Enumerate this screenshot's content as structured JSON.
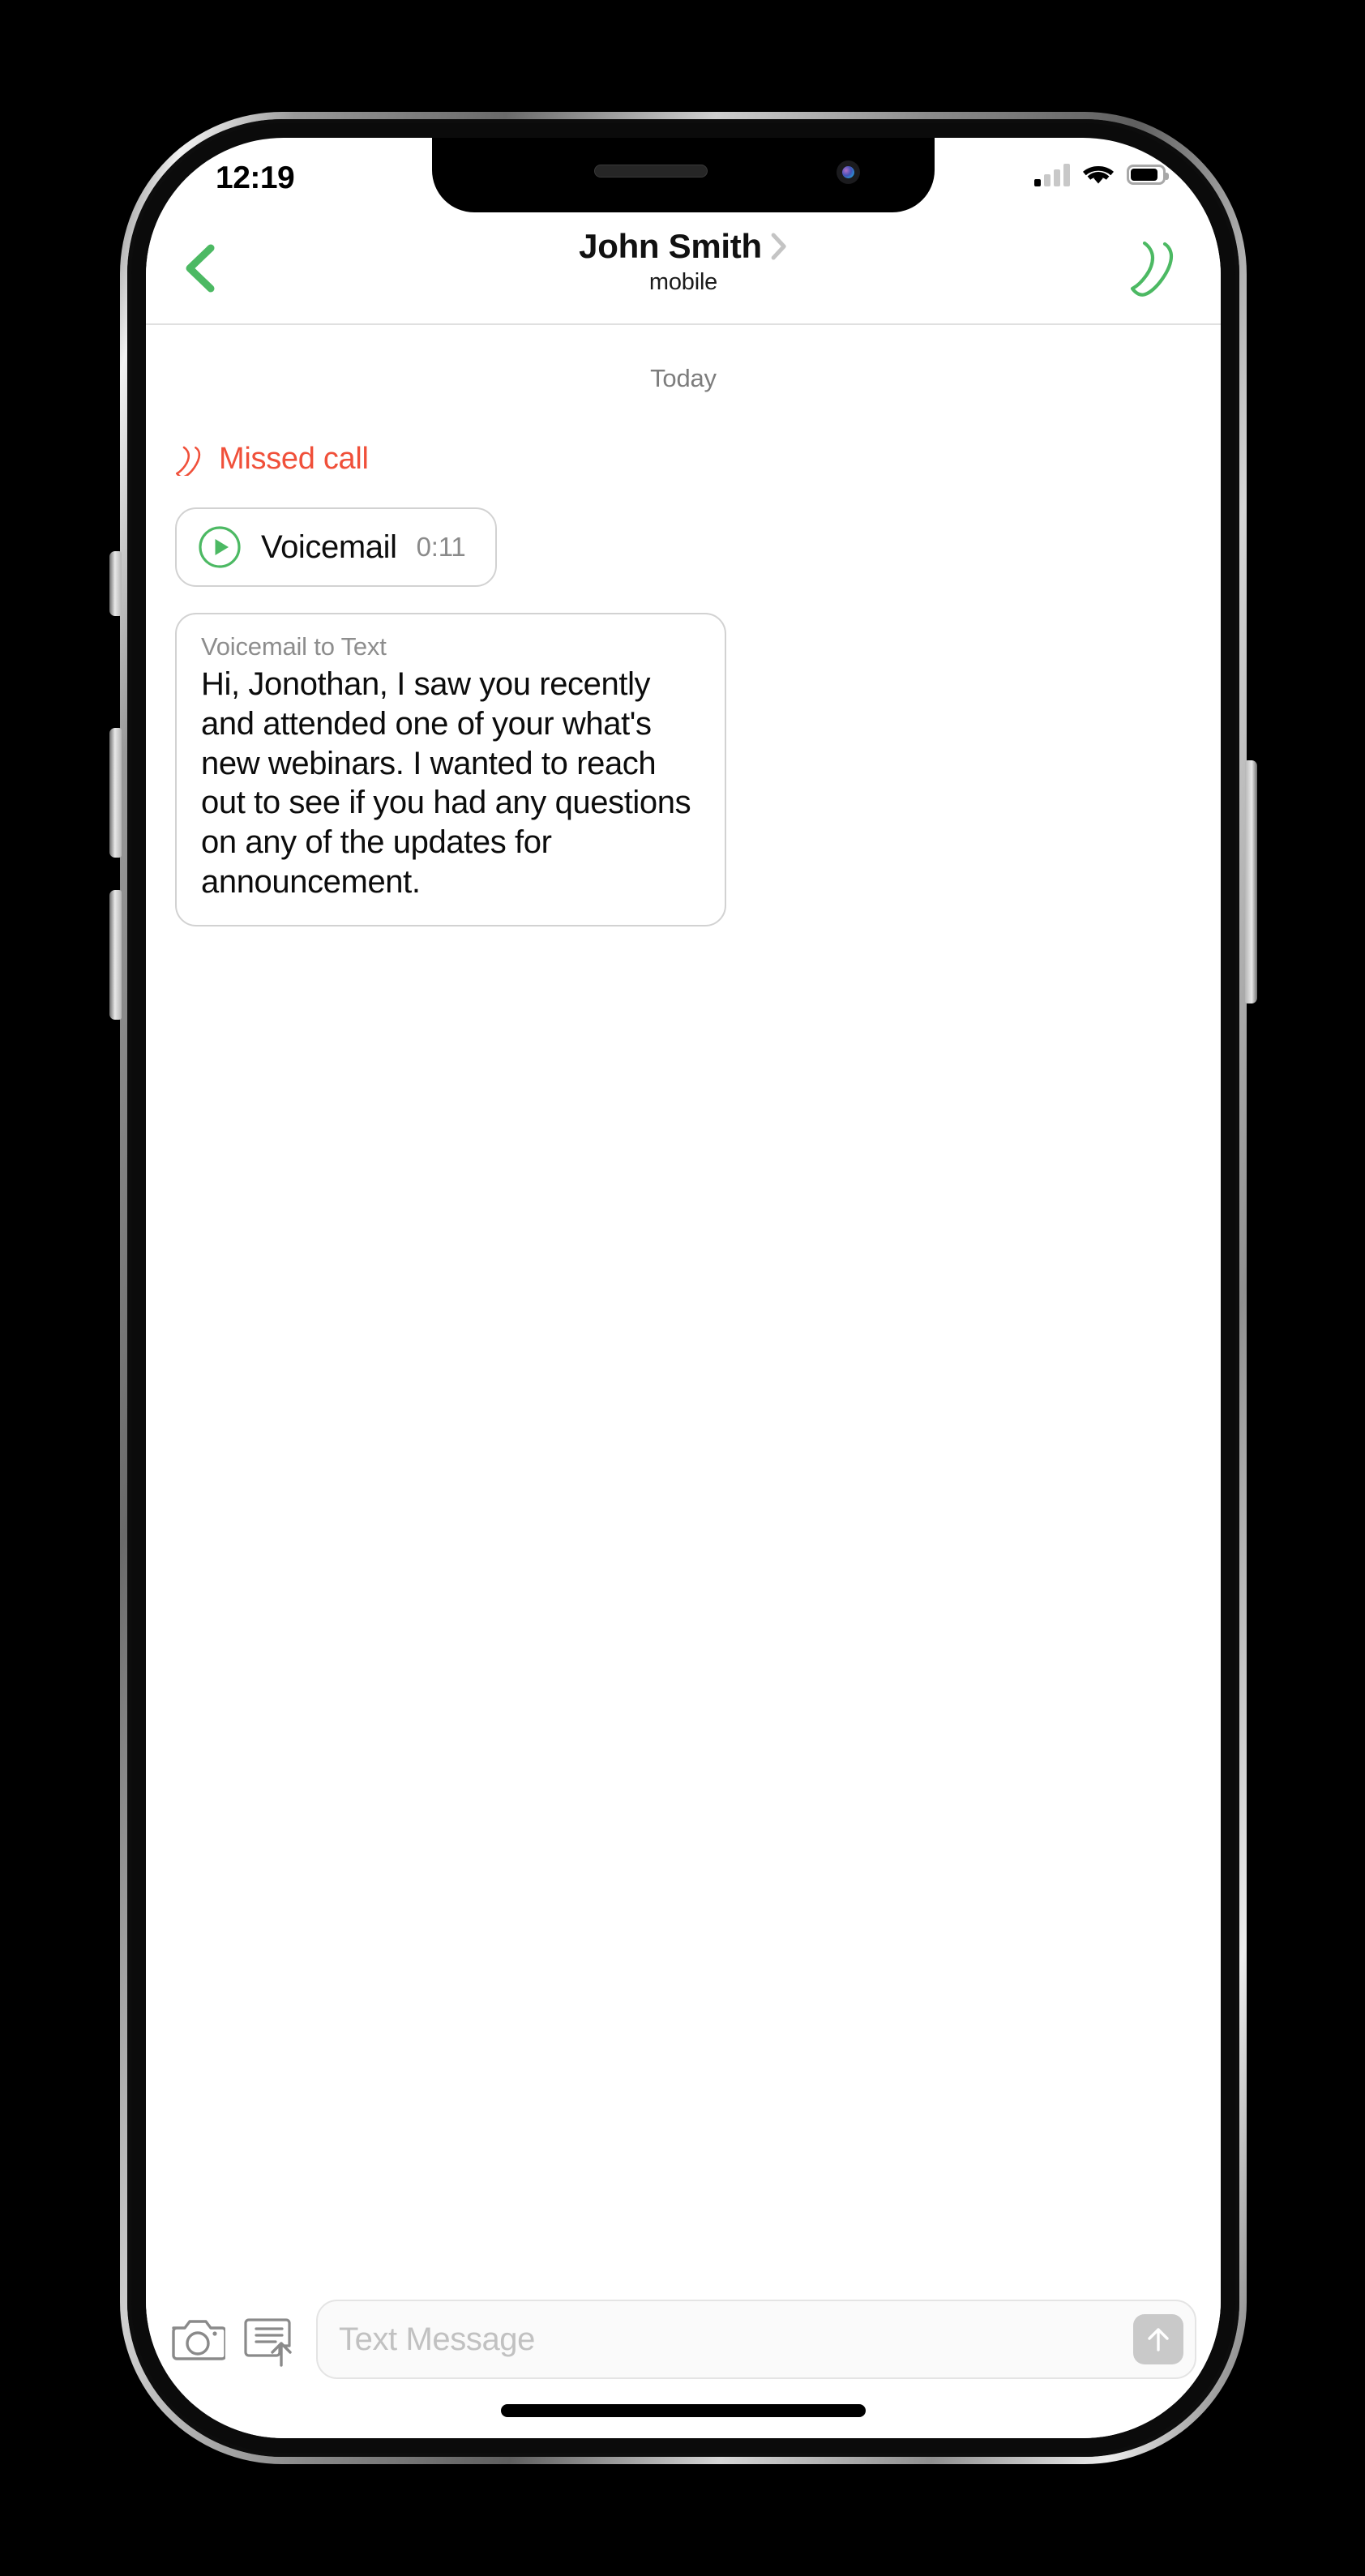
{
  "status_bar": {
    "time": "12:19",
    "signal_icon": "cellular-signal-icon",
    "signal_bars_total": 4,
    "signal_bars_active": 1,
    "wifi_icon": "wifi-icon",
    "battery_icon": "battery-icon",
    "battery_level_percent": 78
  },
  "nav_header": {
    "back_icon": "back-chevron-icon",
    "contact_name": "John Smith",
    "contact_chevron_icon": "chevron-right-icon",
    "contact_subtitle": "mobile",
    "call_icon": "phone-call-icon"
  },
  "conversation": {
    "day_divider": "Today",
    "missed_call": {
      "icon": "missed-call-phone-icon",
      "label": "Missed call",
      "color": "#f0503a"
    },
    "voicemail": {
      "play_icon": "play-circle-icon",
      "label": "Voicemail",
      "duration": "0:11",
      "accent_color": "#4cb963"
    },
    "transcript": {
      "title": "Voicemail to Text",
      "body": "Hi, Jonothan, I saw you recently and attended one of your what's new webinars. I wanted to reach out to see if you had any questions on any of the updates for announcement."
    }
  },
  "input_bar": {
    "camera_icon": "camera-icon",
    "doc_upload_icon": "document-upload-icon",
    "placeholder": "Text Message",
    "value": "",
    "send_icon": "arrow-up-icon"
  },
  "device": {
    "notch_speaker": "speaker-grille",
    "front_camera": "front-camera-icon",
    "home_indicator": "home-indicator-bar",
    "buttons": {
      "mute": "mute-switch",
      "volume_up": "volume-up-button",
      "volume_down": "volume-down-button",
      "power": "power-button"
    }
  },
  "colors": {
    "accent_green": "#4cb963",
    "alert_red": "#f0503a",
    "muted_gray": "#8a8a8a",
    "border_gray": "#d2d2d2"
  }
}
